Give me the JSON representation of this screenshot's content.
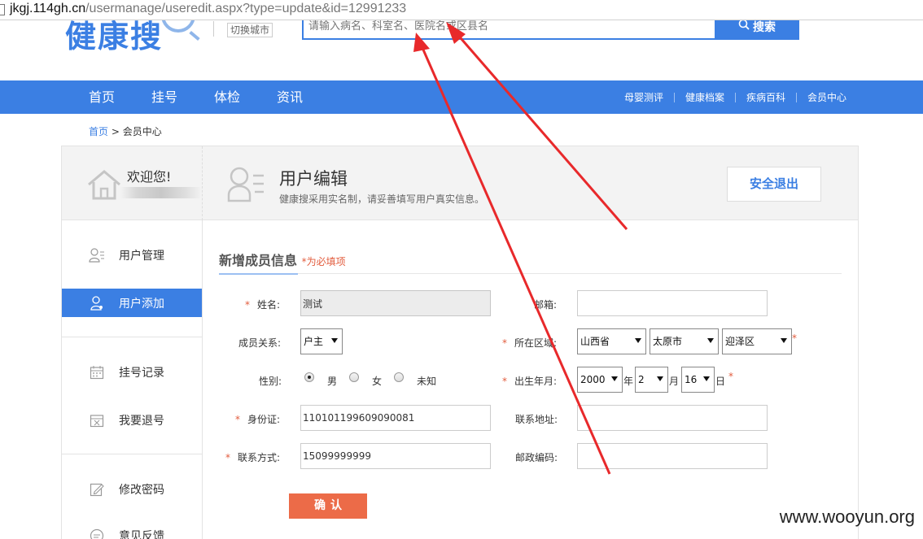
{
  "browser": {
    "url_host": "jkgj.114gh.cn",
    "url_path": "/usermanage/useredit.aspx?type=update&id=12991233"
  },
  "header": {
    "logo_text": "健康搜",
    "city_switch": "切换城市",
    "search_placeholder": "请输入病名、科室名、医院名或区县名",
    "search_button": "搜索"
  },
  "nav": {
    "main": [
      "首页",
      "挂号",
      "体检",
      "资讯"
    ],
    "right": [
      "母婴测评",
      "健康档案",
      "疾病百科",
      "会员中心"
    ]
  },
  "breadcrumb": {
    "home": "首页",
    "sep": ">",
    "current": "会员中心"
  },
  "panel": {
    "welcome": "欢迎您!",
    "title": "用户编辑",
    "subtitle": "健康搜采用实名制，请妥善填写用户真实信息。",
    "logout": "安全退出"
  },
  "sidebar": {
    "items": [
      {
        "label": "用户管理",
        "icon": "user-list-icon"
      },
      {
        "label": "用户添加",
        "icon": "user-add-icon",
        "active": true
      },
      {
        "label": "挂号记录",
        "icon": "calendar-icon"
      },
      {
        "label": "我要退号",
        "icon": "calendar-cancel-icon"
      },
      {
        "label": "修改密码",
        "icon": "edit-icon"
      },
      {
        "label": "意见反馈",
        "icon": "feedback-icon"
      }
    ]
  },
  "form": {
    "title": "新增成员信息",
    "required_note": "*为必填项",
    "name_label": "姓名:",
    "name_value": "测试",
    "email_label": "邮箱:",
    "email_value": "",
    "relation_label": "成员关系:",
    "relation_value": "户主",
    "region_label": "所在区域:",
    "province": "山西省",
    "city": "太原市",
    "district": "迎泽区",
    "gender_label": "性别:",
    "gender_options": [
      "男",
      "女",
      "未知"
    ],
    "gender_selected": "男",
    "birth_label": "出生年月:",
    "birth_year": "2000",
    "birth_year_unit": "年",
    "birth_month": "2",
    "birth_month_unit": "月",
    "birth_day": "16",
    "birth_day_unit": "日",
    "id_label": "身份证:",
    "id_value": "110101199609090081",
    "address_label": "联系地址:",
    "address_value": "",
    "phone_label": "联系方式:",
    "phone_value": "15099999999",
    "zip_label": "邮政编码:",
    "zip_value": "",
    "confirm_button": "确认"
  },
  "colors": {
    "brand_blue": "#3b7fe3",
    "required_red": "#e25c3d",
    "confirm_orange": "#ec6b48",
    "arrow_red": "#e8292b"
  },
  "watermark": "www.wooyun.org"
}
